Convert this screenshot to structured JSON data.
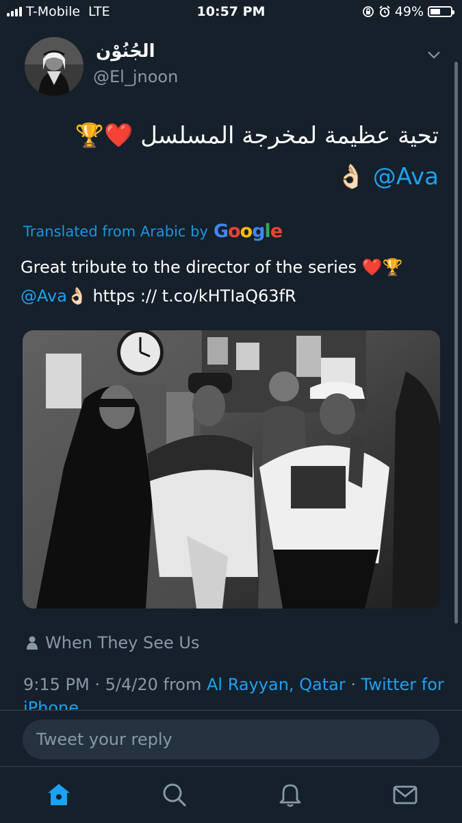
{
  "status_bar": {
    "carrier": "T-Mobile",
    "network": "LTE",
    "time": "10:57 PM",
    "battery": "49%",
    "battery_level": 0.49
  },
  "tweet": {
    "author_name": "الجُنُوْن",
    "author_handle": "@El_jnoon",
    "text_arabic_line1": "تحية عظيمة لمخرجة المسلسل ❤️🏆",
    "text_arabic_mention": "@Ava",
    "text_arabic_emoji": "👌🏻",
    "translated_label": "Translated from Arabic by",
    "translator_brand": "Google",
    "translation_line1": "Great tribute to the director of the series ❤️🏆",
    "translation_mention": "@Ava",
    "translation_emoji": "👌🏻",
    "translation_link": " https :// t.co/kHTIaQ63fR",
    "context_label": "When They See Us",
    "time": "9:15 PM",
    "date": "5/4/20",
    "from_label": "from",
    "location": "Al Rayyan, Qatar",
    "source": "Twitter for iPhone",
    "separator": "·"
  },
  "reply": {
    "placeholder": "Tweet your reply"
  },
  "tabs": [
    "home",
    "search",
    "notifications",
    "messages"
  ],
  "colors": {
    "background": "#15202b",
    "accent": "#1da1f2",
    "muted": "#8899a6"
  }
}
